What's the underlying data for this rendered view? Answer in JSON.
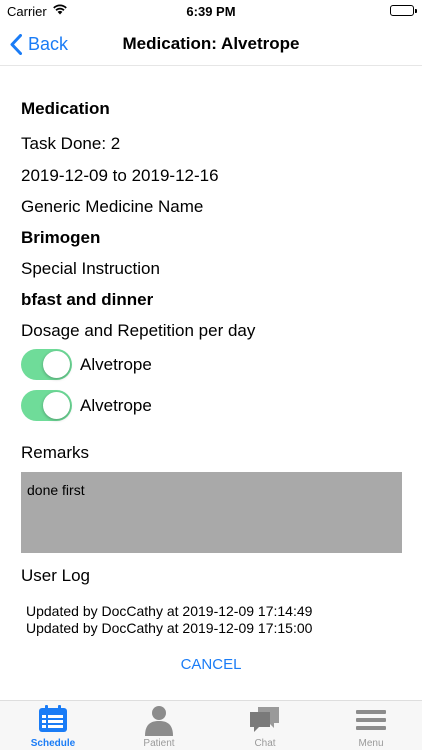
{
  "status_bar": {
    "carrier": "Carrier",
    "time": "6:39 PM"
  },
  "nav": {
    "back_label": "Back",
    "title": "Medication: Alvetrope"
  },
  "details": {
    "section_title": "Medication",
    "task_done": "Task Done: 2",
    "date_range": "2019-12-09 to 2019-12-16",
    "generic_label": "Generic Medicine Name",
    "generic_value": "Brimogen",
    "instruction_label": "Special Instruction",
    "instruction_value": "bfast and dinner",
    "dosage_label": "Dosage and Repetition per day",
    "doses": [
      {
        "label": "Alvetrope",
        "on": true
      },
      {
        "label": "Alvetrope",
        "on": true
      }
    ],
    "remarks_label": "Remarks",
    "remarks_value": "done first",
    "user_log_label": "User Log",
    "log_entries": [
      "Updated by DocCathy at 2019-12-09 17:14:49",
      "Updated by DocCathy at 2019-12-09 17:15:00"
    ],
    "cancel_label": "CANCEL"
  },
  "tabs": [
    {
      "label": "Schedule",
      "active": true
    },
    {
      "label": "Patient",
      "active": false
    },
    {
      "label": "Chat",
      "active": false
    },
    {
      "label": "Menu",
      "active": false
    }
  ],
  "colors": {
    "accent": "#1a7cf6",
    "toggle_on": "#6fdc99",
    "remarks_bg": "#a9a9a9",
    "tab_inactive": "#9a9a9a"
  }
}
